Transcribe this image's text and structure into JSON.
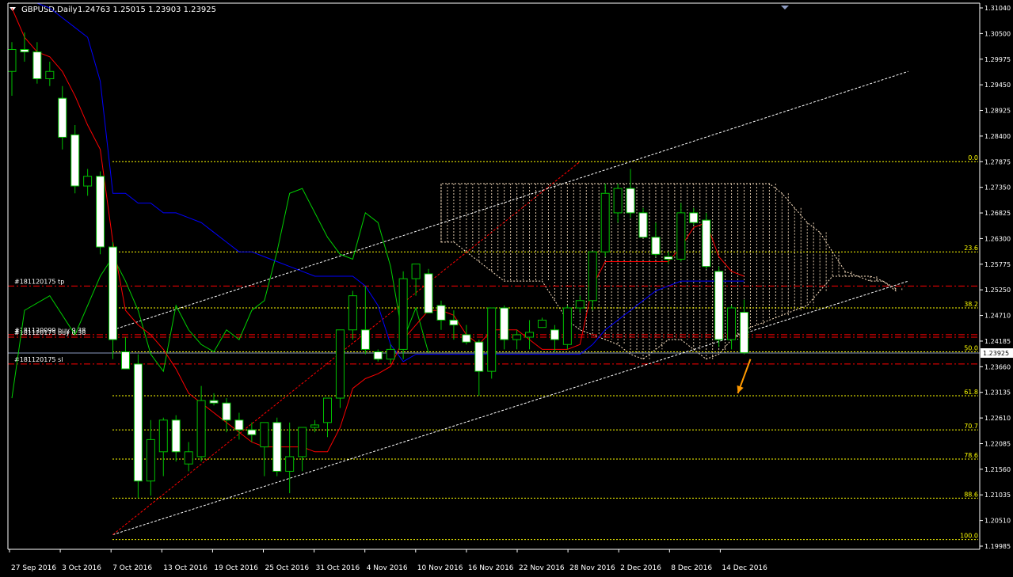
{
  "window": {
    "title": "GBPUSD,Daily",
    "ohlc": "1.24763 1.25015 1.23903 1.23925",
    "menu_icon": "triangle-down-icon",
    "scroll_marker_icon": "triangle-down-icon"
  },
  "colors": {
    "background": "#000000",
    "axis": "#ffffff",
    "bull_body": "#000000",
    "bear_body": "#ffffff",
    "candle_wick": "#00c000",
    "tenkan": "#ff0000",
    "kijun": "#0000ff",
    "chikou": "#00d000",
    "cloud": "#ffe4c4",
    "fibo": "#ffff00",
    "order_line": "#ff0000",
    "channel": "#ffffff",
    "bid_line": "#8c9ac0",
    "arrow": "#ff9900"
  },
  "chart_data": {
    "type": "candlestick",
    "symbol": "GBPUSD",
    "timeframe": "Daily",
    "ylim": [
      1.199,
      1.311
    ],
    "y_ticks": [
      "1.31040",
      "1.30500",
      "1.29975",
      "1.29450",
      "1.28925",
      "1.28400",
      "1.27875",
      "1.27350",
      "1.26825",
      "1.26300",
      "1.25775",
      "1.25250",
      "1.24710",
      "1.24185",
      "1.23660",
      "1.23135",
      "1.22610",
      "1.22085",
      "1.21560",
      "1.21035",
      "1.20510",
      "1.19985"
    ],
    "x_labels": [
      "27 Sep 2016",
      "3 Oct 2016",
      "7 Oct 2016",
      "13 Oct 2016",
      "19 Oct 2016",
      "25 Oct 2016",
      "31 Oct 2016",
      "4 Nov 2016",
      "10 Nov 2016",
      "16 Nov 2016",
      "22 Nov 2016",
      "28 Nov 2016",
      "2 Dec 2016",
      "8 Dec 2016",
      "14 Dec 2016"
    ],
    "current_price": "1.23925",
    "current_price_value": 1.23925,
    "candles": [
      [
        1.297,
        1.303,
        1.292,
        1.3015
      ],
      [
        1.3015,
        1.305,
        1.299,
        1.301
      ],
      [
        1.301,
        1.303,
        1.2945,
        1.2955
      ],
      [
        1.2955,
        1.299,
        1.294,
        1.297
      ],
      [
        1.2915,
        1.294,
        1.281,
        1.2835
      ],
      [
        1.284,
        1.286,
        1.272,
        1.2735
      ],
      [
        1.2735,
        1.277,
        1.2715,
        1.2755
      ],
      [
        1.2755,
        1.2765,
        1.2595,
        1.261
      ],
      [
        1.261,
        1.262,
        1.238,
        1.242
      ],
      [
        1.2395,
        1.2425,
        1.2365,
        1.236
      ],
      [
        1.237,
        1.239,
        1.2095,
        1.213
      ],
      [
        1.213,
        1.2255,
        1.21,
        1.2215
      ],
      [
        1.219,
        1.226,
        1.214,
        1.2255
      ],
      [
        1.2255,
        1.2265,
        1.217,
        1.219
      ],
      [
        1.2165,
        1.221,
        1.215,
        1.219
      ],
      [
        1.218,
        1.2325,
        1.217,
        1.2295
      ],
      [
        1.2295,
        1.231,
        1.2285,
        1.229
      ],
      [
        1.229,
        1.23,
        1.223,
        1.2255
      ],
      [
        1.2255,
        1.227,
        1.2215,
        1.2235
      ],
      [
        1.2235,
        1.225,
        1.221,
        1.2225
      ],
      [
        1.22,
        1.225,
        1.214,
        1.225
      ],
      [
        1.225,
        1.226,
        1.214,
        1.215
      ],
      [
        1.215,
        1.225,
        1.2105,
        1.218
      ],
      [
        1.218,
        1.224,
        1.215,
        1.224
      ],
      [
        1.224,
        1.2255,
        1.223,
        1.2245
      ],
      [
        1.225,
        1.23,
        1.222,
        1.23
      ],
      [
        1.23,
        1.243,
        1.228,
        1.244
      ],
      [
        1.244,
        1.252,
        1.242,
        1.251
      ],
      [
        1.244,
        1.253,
        1.239,
        1.24
      ],
      [
        1.2395,
        1.24,
        1.2375,
        1.238
      ],
      [
        1.238,
        1.241,
        1.237,
        1.24
      ],
      [
        1.24,
        1.256,
        1.238,
        1.2545
      ],
      [
        1.2545,
        1.257,
        1.251,
        1.2575
      ],
      [
        1.2555,
        1.2565,
        1.2475,
        1.2475
      ],
      [
        1.249,
        1.25,
        1.244,
        1.246
      ],
      [
        1.246,
        1.248,
        1.242,
        1.245
      ],
      [
        1.243,
        1.245,
        1.241,
        1.2415
      ],
      [
        1.2415,
        1.242,
        1.2305,
        1.2355
      ],
      [
        1.2355,
        1.2435,
        1.234,
        1.2485
      ],
      [
        1.2485,
        1.249,
        1.24,
        1.242
      ],
      [
        1.242,
        1.244,
        1.24,
        1.243
      ],
      [
        1.2425,
        1.246,
        1.24,
        1.2435
      ],
      [
        1.2445,
        1.2465,
        1.2445,
        1.246
      ],
      [
        1.244,
        1.245,
        1.2395,
        1.242
      ],
      [
        1.241,
        1.249,
        1.24,
        1.2485
      ],
      [
        1.2485,
        1.251,
        1.2475,
        1.25
      ],
      [
        1.25,
        1.26,
        1.248,
        1.26
      ],
      [
        1.26,
        1.274,
        1.259,
        1.272
      ],
      [
        1.268,
        1.274,
        1.266,
        1.273
      ],
      [
        1.273,
        1.277,
        1.267,
        1.268
      ],
      [
        1.268,
        1.269,
        1.263,
        1.263
      ],
      [
        1.263,
        1.266,
        1.259,
        1.2595
      ],
      [
        1.259,
        1.26,
        1.2575,
        1.2585
      ],
      [
        1.2585,
        1.27,
        1.258,
        1.268
      ],
      [
        1.268,
        1.269,
        1.2655,
        1.266
      ],
      [
        1.2665,
        1.268,
        1.2565,
        1.257
      ],
      [
        1.256,
        1.257,
        1.2405,
        1.242
      ],
      [
        1.242,
        1.249,
        1.24,
        1.2485
      ],
      [
        1.2476,
        1.2502,
        1.239,
        1.2393
      ]
    ],
    "tenkan": [
      1.31,
      1.304,
      1.301,
      1.3,
      1.297,
      1.292,
      1.286,
      1.281,
      1.262,
      1.248,
      1.245,
      1.243,
      1.24,
      1.236,
      1.231,
      1.229,
      1.227,
      1.225,
      1.223,
      1.221,
      1.22,
      1.22,
      1.22,
      1.22,
      1.219,
      1.219,
      1.224,
      1.232,
      1.234,
      1.235,
      1.2365,
      1.242,
      1.245,
      1.248,
      1.248,
      1.247,
      1.243,
      1.241,
      1.244,
      1.244,
      1.244,
      1.242,
      1.24,
      1.24,
      1.24,
      1.241,
      1.253,
      1.258,
      1.258,
      1.258,
      1.258,
      1.258,
      1.258,
      1.261,
      1.265,
      1.266,
      1.259,
      1.256,
      1.255
    ],
    "kijun": [
      1.311,
      1.311,
      1.311,
      1.31,
      1.308,
      1.306,
      1.304,
      1.295,
      1.272,
      1.272,
      1.27,
      1.27,
      1.268,
      1.268,
      1.267,
      1.266,
      1.264,
      1.262,
      1.26,
      1.26,
      1.259,
      1.258,
      1.257,
      1.256,
      1.255,
      1.255,
      1.255,
      1.255,
      1.253,
      1.249,
      1.241,
      1.2375,
      1.239,
      1.239,
      1.239,
      1.239,
      1.239,
      1.239,
      1.239,
      1.239,
      1.239,
      1.239,
      1.239,
      1.239,
      1.239,
      1.239,
      1.241,
      1.244,
      1.246,
      1.248,
      1.25,
      1.252,
      1.253,
      1.254,
      1.254,
      1.254,
      1.254,
      1.254,
      1.254
    ],
    "chikou": [
      [
        0,
        1.23
      ],
      [
        1,
        1.248
      ],
      [
        3,
        1.251
      ],
      [
        5,
        1.243
      ],
      [
        7,
        1.255
      ],
      [
        8,
        1.259
      ],
      [
        9,
        1.254
      ],
      [
        10,
        1.248
      ],
      [
        11,
        1.239
      ],
      [
        12,
        1.2355
      ],
      [
        13,
        1.249
      ],
      [
        14,
        1.244
      ],
      [
        15,
        1.241
      ],
      [
        16,
        1.2395
      ],
      [
        17,
        1.244
      ],
      [
        18,
        1.242
      ],
      [
        19,
        1.248
      ],
      [
        20,
        1.25
      ],
      [
        21,
        1.26
      ],
      [
        22,
        1.272
      ],
      [
        23,
        1.273
      ],
      [
        24,
        1.268
      ],
      [
        25,
        1.263
      ],
      [
        26,
        1.2595
      ],
      [
        27,
        1.2585
      ],
      [
        28,
        1.268
      ],
      [
        29,
        1.266
      ],
      [
        30,
        1.257
      ],
      [
        31,
        1.242
      ],
      [
        32,
        1.2485
      ],
      [
        33,
        1.2393
      ]
    ],
    "cloud_upper": [
      [
        34,
        1.262
      ],
      [
        35,
        1.262
      ],
      [
        36,
        1.26
      ],
      [
        37,
        1.258
      ],
      [
        38,
        1.256
      ],
      [
        39,
        1.254
      ],
      [
        40,
        1.254
      ],
      [
        41,
        1.254
      ],
      [
        42,
        1.254
      ],
      [
        43,
        1.25
      ],
      [
        44,
        1.246
      ],
      [
        45,
        1.244
      ],
      [
        46,
        1.243
      ],
      [
        47,
        1.242
      ],
      [
        48,
        1.241
      ],
      [
        49,
        1.239
      ],
      [
        50,
        1.238
      ],
      [
        51,
        1.24
      ],
      [
        52,
        1.242
      ],
      [
        53,
        1.242
      ],
      [
        54,
        1.24
      ],
      [
        55,
        1.238
      ],
      [
        56,
        1.239
      ],
      [
        57,
        1.242
      ],
      [
        58,
        1.244
      ],
      [
        59,
        1.245
      ],
      [
        60,
        1.246
      ],
      [
        61,
        1.247
      ],
      [
        62,
        1.248
      ],
      [
        63,
        1.249
      ],
      [
        64,
        1.252
      ],
      [
        65,
        1.255
      ],
      [
        66,
        1.255
      ],
      [
        67,
        1.255
      ],
      [
        68,
        1.255
      ],
      [
        69,
        1.254
      ],
      [
        70,
        1.252
      ]
    ],
    "cloud_lower": [
      [
        34,
        1.274
      ],
      [
        35,
        1.274
      ],
      [
        36,
        1.274
      ],
      [
        37,
        1.274
      ],
      [
        38,
        1.274
      ],
      [
        39,
        1.274
      ],
      [
        40,
        1.274
      ],
      [
        41,
        1.274
      ],
      [
        42,
        1.274
      ],
      [
        43,
        1.274
      ],
      [
        44,
        1.274
      ],
      [
        45,
        1.274
      ],
      [
        46,
        1.274
      ],
      [
        47,
        1.274
      ],
      [
        48,
        1.274
      ],
      [
        49,
        1.274
      ],
      [
        50,
        1.274
      ],
      [
        51,
        1.274
      ],
      [
        52,
        1.274
      ],
      [
        53,
        1.274
      ],
      [
        54,
        1.274
      ],
      [
        55,
        1.274
      ],
      [
        56,
        1.274
      ],
      [
        57,
        1.274
      ],
      [
        58,
        1.274
      ],
      [
        59,
        1.274
      ],
      [
        60,
        1.274
      ],
      [
        61,
        1.272
      ],
      [
        62,
        1.269
      ],
      [
        63,
        1.266
      ],
      [
        64,
        1.264
      ],
      [
        65,
        1.26
      ],
      [
        66,
        1.256
      ],
      [
        67,
        1.255
      ],
      [
        68,
        1.254
      ],
      [
        69,
        1.254
      ],
      [
        70,
        1.2525
      ]
    ],
    "fibonacci": [
      {
        "level": "0.0",
        "price": 1.2785
      },
      {
        "level": "23.6",
        "price": 1.26
      },
      {
        "level": "38.2",
        "price": 1.2485
      },
      {
        "level": "50.0",
        "price": 1.2395
      },
      {
        "level": "61.8",
        "price": 1.2305
      },
      {
        "level": "70.7",
        "price": 1.2235
      },
      {
        "level": "78.6",
        "price": 1.2175
      },
      {
        "level": "88.6",
        "price": 1.2095
      },
      {
        "level": "100.0",
        "price": 1.201
      }
    ],
    "orders": [
      {
        "label": "#181120175 tp",
        "price": 1.253
      },
      {
        "label": "#181120099 buy 0.38",
        "price": 1.243
      },
      {
        "label": "#181120175 buy 0.38",
        "price": 1.2425
      },
      {
        "label": "#181120175 sl",
        "price": 1.237
      }
    ],
    "channel_lines": [
      {
        "from": [
          8,
          1.244
        ],
        "to": [
          71,
          1.297
        ]
      },
      {
        "from": [
          8,
          1.202
        ],
        "to": [
          71,
          1.254
        ]
      }
    ],
    "trend_line": {
      "from": [
        8,
        1.202
      ],
      "to": [
        45,
        1.2785
      ]
    },
    "arrow": {
      "from": [
        58.5,
        1.238
      ],
      "to": [
        57.5,
        1.231
      ]
    }
  }
}
